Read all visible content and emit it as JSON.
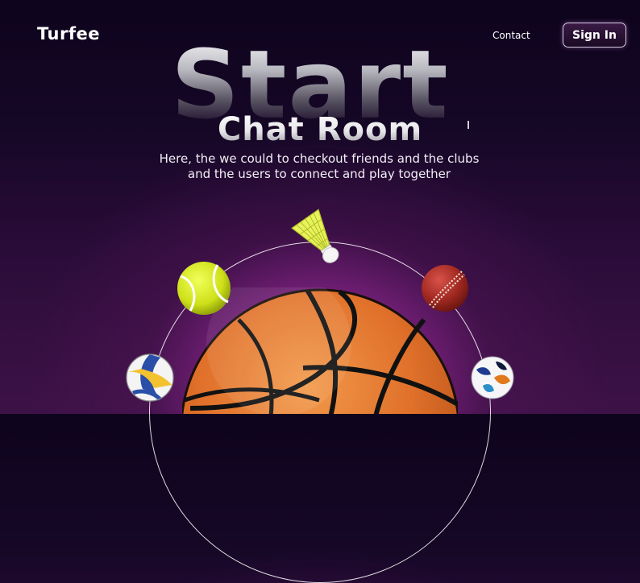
{
  "header": {
    "logo": "Turfee",
    "nav_contact": "Contact",
    "signin_label": "Sign In"
  },
  "hero": {
    "big_word": "Start",
    "title": "Chat Room",
    "description": "Here, the we could to checkout friends and the clubs and the users to connect and play together"
  },
  "colors": {
    "background": "#150726",
    "glow": "#d64ad6",
    "text": "#ffffff"
  },
  "icons": [
    "basketball-icon",
    "tennis-ball-icon",
    "shuttlecock-icon",
    "cricket-ball-icon",
    "volleyball-icon",
    "football-icon"
  ]
}
